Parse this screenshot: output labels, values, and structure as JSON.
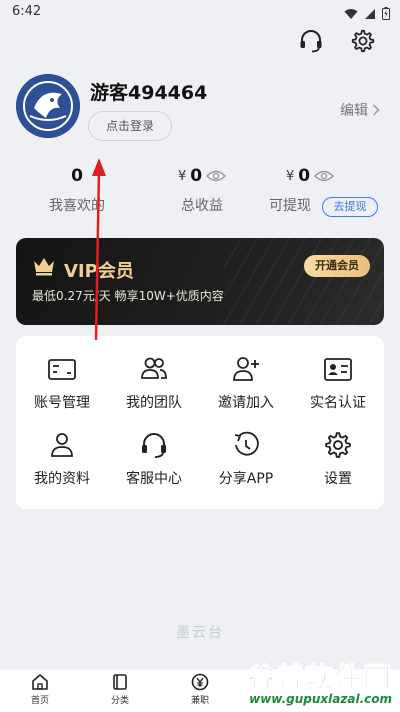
{
  "status_bar": {
    "time": "6:42"
  },
  "header": {
    "support_icon": "headset-icon",
    "settings_icon": "gear-icon"
  },
  "profile": {
    "username": "游客494464",
    "login_button": "点击登录",
    "edit_label": "编辑"
  },
  "stats": [
    {
      "value": "0",
      "label": "我喜欢的",
      "currency": ""
    },
    {
      "value": "0",
      "label": "总收益",
      "currency": "¥"
    },
    {
      "value": "0",
      "label": "可提现",
      "currency": "¥"
    }
  ],
  "withdraw_button": "去提现",
  "vip": {
    "title": "VIP会员",
    "subtitle": "最低0.27元/天 畅享10W+优质内容",
    "button": "开通会员",
    "accent": "#f1cf8e"
  },
  "grid": [
    {
      "label": "账号管理",
      "icon": "id-card-icon"
    },
    {
      "label": "我的团队",
      "icon": "team-icon"
    },
    {
      "label": "邀请加入",
      "icon": "invite-user-icon"
    },
    {
      "label": "实名认证",
      "icon": "verify-card-icon"
    },
    {
      "label": "我的资料",
      "icon": "profile-icon"
    },
    {
      "label": "客服中心",
      "icon": "headset-icon"
    },
    {
      "label": "分享APP",
      "icon": "share-refresh-icon"
    },
    {
      "label": "设置",
      "icon": "gear-icon"
    }
  ],
  "footer_brand": "墨云台",
  "bottom_nav": [
    {
      "label": "首页",
      "icon": "home-icon"
    },
    {
      "label": "分类",
      "icon": "category-icon"
    },
    {
      "label": "兼职",
      "icon": "yen-icon"
    }
  ],
  "watermark": {
    "main": "谷普软件园",
    "url": "www.gupuxlazal.com"
  },
  "colors": {
    "link_blue": "#3c7bf0",
    "annotation_red": "#e02020",
    "watermark_green": "#2ea84a"
  }
}
